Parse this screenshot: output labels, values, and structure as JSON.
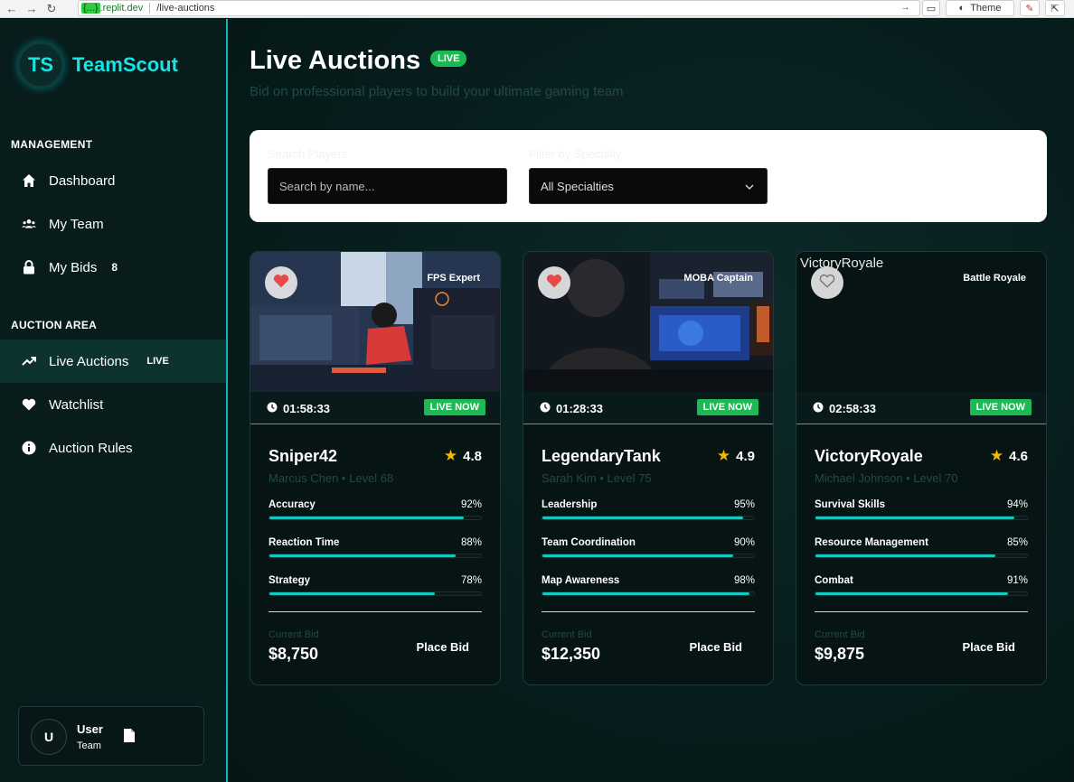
{
  "browser": {
    "badge": "{...}",
    "host": ".replit.dev",
    "path": "/live-auctions",
    "theme_label": "Theme"
  },
  "sidebar": {
    "logo_mark": "TS",
    "brand": "TeamScout",
    "management_label": "MANAGEMENT",
    "auction_label": "AUCTION AREA",
    "items": [
      {
        "label": "Dashboard",
        "icon": "home-icon"
      },
      {
        "label": "My Team",
        "icon": "users-icon"
      },
      {
        "label": "My Bids",
        "icon": "lock-icon",
        "count": "8"
      },
      {
        "label": "Live Auctions",
        "icon": "trend-icon",
        "tag": "LIVE"
      },
      {
        "label": "Watchlist",
        "icon": "heart-icon"
      },
      {
        "label": "Auction Rules",
        "icon": "info-icon"
      }
    ],
    "user": {
      "initial": "U",
      "name": "User",
      "team": "Team"
    }
  },
  "main": {
    "title": "Live Auctions",
    "live_pill": "LIVE",
    "subtitle": "Bid on professional players to build your ultimate gaming team",
    "filters": {
      "search_label": "Search Players",
      "search_placeholder": "Search by name...",
      "specialty_label": "Filter by Specialty",
      "specialty_value": "All Specialties"
    },
    "cards": [
      {
        "name": "Sniper42",
        "specialty": "FPS Expert",
        "timer": "01:58:33",
        "live": "LIVE NOW",
        "rating": "4.8",
        "sub": "Marcus Chen • Level 68",
        "stats": [
          {
            "label": "Accuracy",
            "value": "92%",
            "pct": 92
          },
          {
            "label": "Reaction Time",
            "value": "88%",
            "pct": 88
          },
          {
            "label": "Strategy",
            "value": "78%",
            "pct": 78
          }
        ],
        "bid_label": "Current Bid",
        "bid": "$8,750",
        "bid_btn": "Place Bid",
        "favorited": true
      },
      {
        "name": "LegendaryTank",
        "specialty": "MOBA Captain",
        "timer": "01:28:33",
        "live": "LIVE NOW",
        "rating": "4.9",
        "sub": "Sarah Kim • Level 75",
        "stats": [
          {
            "label": "Leadership",
            "value": "95%",
            "pct": 95
          },
          {
            "label": "Team Coordination",
            "value": "90%",
            "pct": 90
          },
          {
            "label": "Map Awareness",
            "value": "98%",
            "pct": 98
          }
        ],
        "bid_label": "Current Bid",
        "bid": "$12,350",
        "bid_btn": "Place Bid",
        "favorited": true
      },
      {
        "name": "VictoryRoyale",
        "specialty": "Battle Royale",
        "timer": "02:58:33",
        "live": "LIVE NOW",
        "rating": "4.6",
        "sub": "Michael Johnson • Level 70",
        "image_alt": "VictoryRoyale",
        "stats": [
          {
            "label": "Survival Skills",
            "value": "94%",
            "pct": 94
          },
          {
            "label": "Resource Management",
            "value": "85%",
            "pct": 85
          },
          {
            "label": "Combat",
            "value": "91%",
            "pct": 91
          }
        ],
        "bid_label": "Current Bid",
        "bid": "$9,875",
        "bid_btn": "Place Bid",
        "favorited": false
      }
    ]
  }
}
